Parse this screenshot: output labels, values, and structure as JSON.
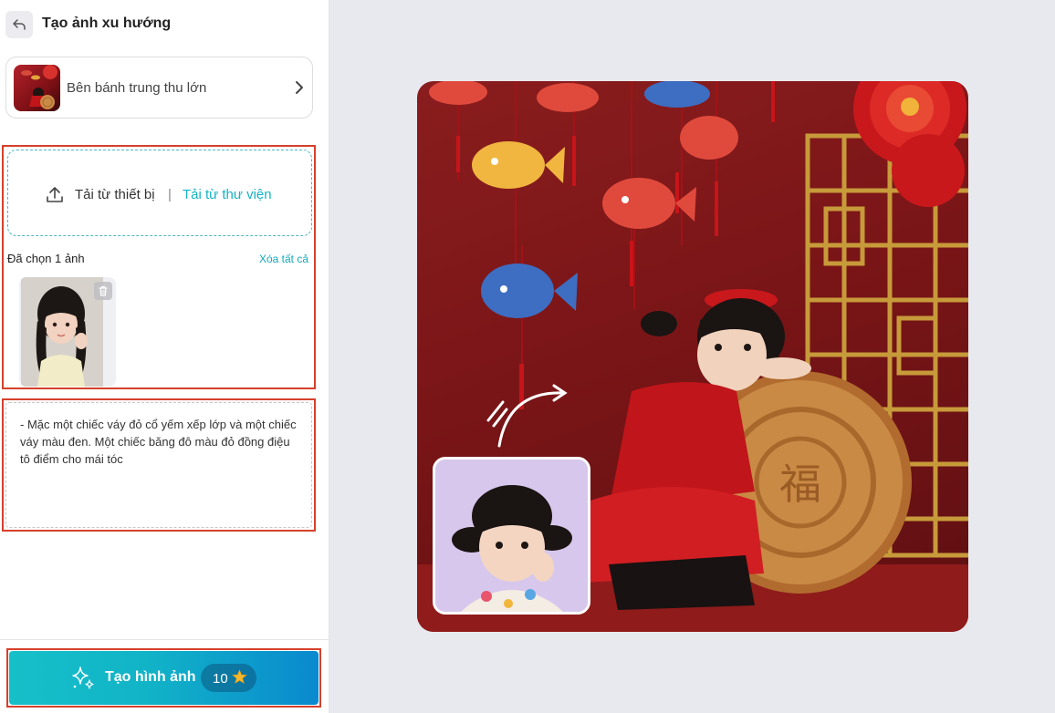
{
  "header": {
    "title": "Tạo ảnh xu hướng",
    "back_icon": "undo-arrow-icon"
  },
  "template": {
    "label": "Bên bánh trung thu lớn",
    "chevron_icon": "chevron-right-icon"
  },
  "upload": {
    "device_label": "Tải từ thiết bị",
    "separator": "|",
    "library_label": "Tải từ thư viện",
    "upload_icon": "upload-icon",
    "accent_color": "#13b3c5"
  },
  "selection": {
    "count_label": "Đã chọn 1 ảnh",
    "clear_label": "Xóa tất cả",
    "delete_icon": "trash-icon"
  },
  "prompt": {
    "text": "- Mặc một chiếc váy đỏ cổ yếm xếp lớp và một chiếc váy màu đen. Một chiếc băng đô màu đỏ đồng điệu tô điểm cho mái tóc"
  },
  "generate": {
    "label": "Tạo hình ảnh",
    "credits": "10",
    "icon": "sparkles-icon",
    "credit_icon": "star-icon",
    "highlight_color": "#d6402b"
  }
}
